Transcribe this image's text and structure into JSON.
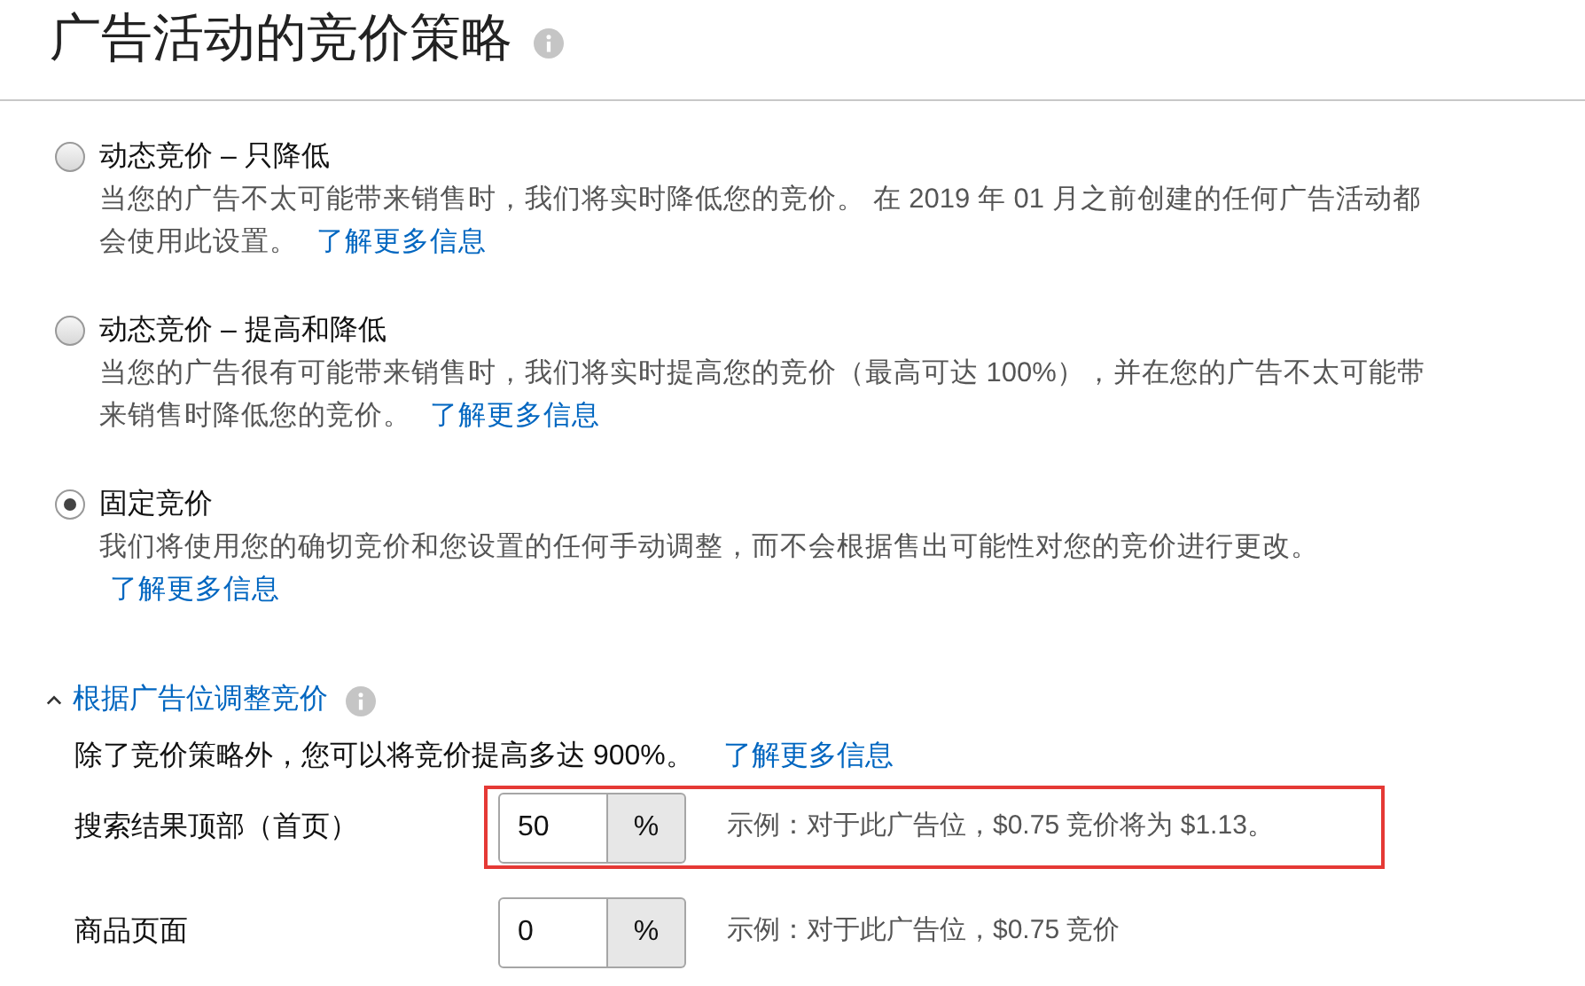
{
  "title": "广告活动的竞价策略",
  "strategies": [
    {
      "label": "动态竞价 – 只降低",
      "description": "当您的广告不太可能带来销售时，我们将实时降低您的竞价。 在 2019 年 01 月之前创建的任何广告活动都会使用此设置。",
      "link": "了解更多信息",
      "selected": false
    },
    {
      "label": "动态竞价 – 提高和降低",
      "description": "当您的广告很有可能带来销售时，我们将实时提高您的竞价（最高可达 100%），并在您的广告不太可能带来销售时降低您的竞价。",
      "link": "了解更多信息",
      "selected": false
    },
    {
      "label": "固定竞价",
      "description": "我们将使用您的确切竞价和您设置的任何手动调整，而不会根据售出可能性对您的竞价进行更改。",
      "link": "了解更多信息",
      "selected": true
    }
  ],
  "adjustments": {
    "title": "根据广告位调整竞价",
    "expanded": true,
    "intro": "除了竞价策略外，您可以将竞价提高多达 900%。",
    "link": "了解更多信息",
    "placements": [
      {
        "label": "搜索结果顶部（首页）",
        "value": "50",
        "unit": "%",
        "example": "示例：对于此广告位，$0.75 竞价将为 $1.13。",
        "highlighted": true
      },
      {
        "label": "商品页面",
        "value": "0",
        "unit": "%",
        "example": "示例：对于此广告位，$0.75 竞价",
        "highlighted": false
      }
    ]
  }
}
